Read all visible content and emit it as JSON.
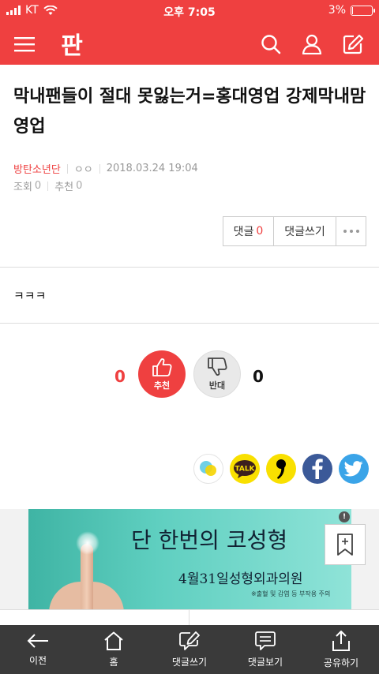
{
  "status_bar": {
    "carrier": "KT",
    "time": "오후 7:05",
    "battery_percent": "3%",
    "battery_level": 0.03
  },
  "header": {
    "logo_text": "판",
    "icons": [
      "menu-icon",
      "search-icon",
      "user-icon",
      "edit-icon"
    ]
  },
  "post": {
    "title": "막내팬들이 절대 못잃는거=홍대영업 강제막내맘영업",
    "category": "방탄소년단",
    "author": "ㅇㅇ",
    "datetime": "2018.03.24 19:04",
    "views_label": "조회",
    "views": "0",
    "recommend_label": "추천",
    "recommend": "0",
    "body": "ㅋㅋㅋ"
  },
  "actions": {
    "comments_label": "댓글",
    "comments_count": "0",
    "write_comment_label": "댓글쓰기"
  },
  "vote": {
    "up_count": "0",
    "up_label": "추천",
    "down_label": "반대",
    "down_count": "0"
  },
  "share": {
    "icons": [
      "kakaostory-icon",
      "kakaotalk-icon",
      "kakaopage-icon",
      "facebook-icon",
      "twitter-icon"
    ],
    "kakaotalk_text": "TALK"
  },
  "ad": {
    "headline": "단 한번의 코성형",
    "subline": "4월31일성형외과의원",
    "fineprint": "※출혈 및 감염 등 부작용 주의",
    "info_badge": "!"
  },
  "bottom_nav": {
    "items": [
      {
        "label": "이전",
        "icon": "back-arrow-icon"
      },
      {
        "label": "홈",
        "icon": "home-icon"
      },
      {
        "label": "댓글쓰기",
        "icon": "write-comment-icon"
      },
      {
        "label": "댓글보기",
        "icon": "view-comments-icon"
      },
      {
        "label": "공유하기",
        "icon": "share-icon"
      }
    ]
  },
  "colors": {
    "brand_red": "#ef4040",
    "nav_dark": "#3a3a3a",
    "facebook": "#3b5998",
    "twitter": "#3aa4e8",
    "kakao_yellow": "#f9e000"
  }
}
